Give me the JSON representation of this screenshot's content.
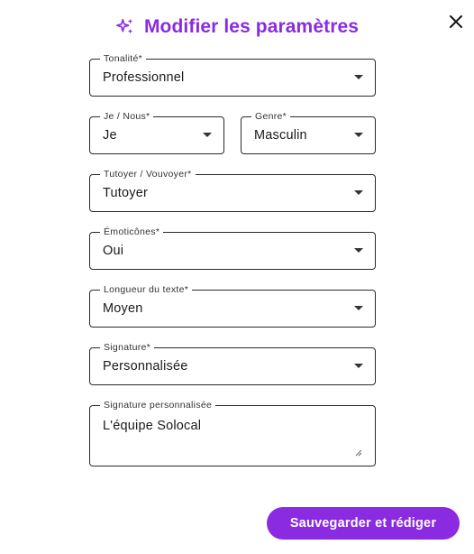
{
  "dialog": {
    "title": "Modifier les paramètres",
    "title_icon": "sparkles-icon",
    "close_icon": "close-icon",
    "accent_color": "#8a2be2"
  },
  "fields": {
    "tonalite": {
      "label": "Tonalité*",
      "value": "Professionnel"
    },
    "je_nous": {
      "label": "Je / Nous*",
      "value": "Je"
    },
    "genre": {
      "label": "Genre*",
      "value": "Masculin"
    },
    "tutoyer": {
      "label": "Tutoyer / Vouvoyer*",
      "value": "Tutoyer"
    },
    "emoticones": {
      "label": "Émoticônes*",
      "value": "Oui"
    },
    "longueur": {
      "label": "Longueur du texte*",
      "value": "Moyen"
    },
    "signature": {
      "label": "Signature*",
      "value": "Personnalisée"
    },
    "signature_perso": {
      "label": "Signature personnalisée",
      "value": "L'équipe Solocal"
    }
  },
  "actions": {
    "save_label": "Sauvegarder et rédiger"
  }
}
